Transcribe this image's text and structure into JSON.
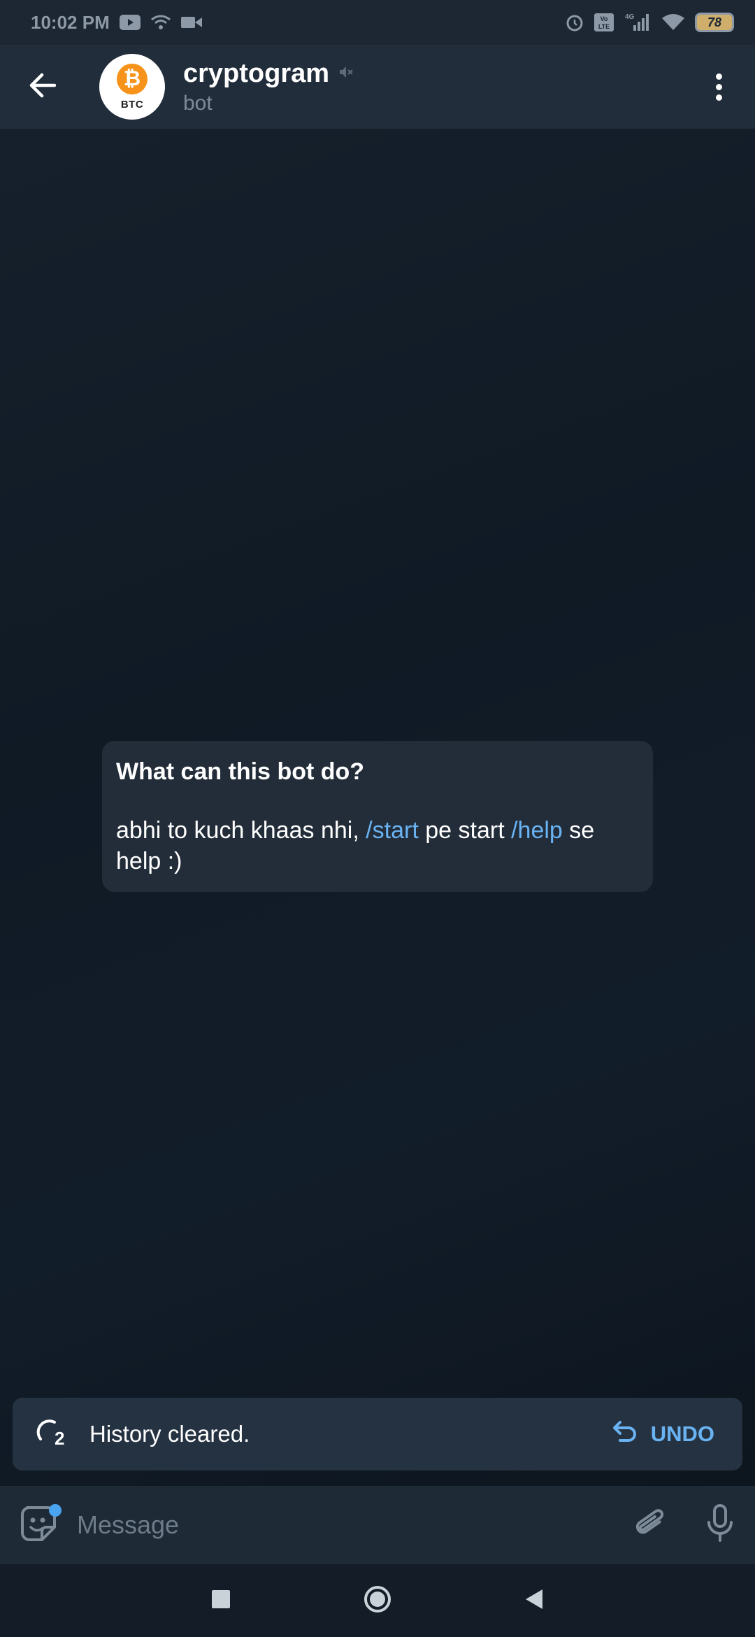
{
  "status_bar": {
    "time": "10:02 PM",
    "left_icons": [
      "youtube-icon",
      "wifi-hotspot-icon",
      "video-icon"
    ],
    "right_icons": [
      "alarm-icon",
      "volte-icon",
      "signal-4g-icon",
      "wifi-icon"
    ],
    "network_label": "4G",
    "volte_label": "Vo LTE",
    "battery": "78"
  },
  "header": {
    "title": "cryptogram",
    "subtitle": "bot",
    "avatar_symbol": "₿",
    "avatar_text": "BTC",
    "muted": true
  },
  "bot_info": {
    "title": "What can this bot do?",
    "body_part1": "abhi to kuch khaas nhi, ",
    "cmd_start": "/start",
    "body_part2": " pe start ",
    "cmd_help": "/help",
    "body_part3": " se help :)"
  },
  "snackbar": {
    "countdown": "2",
    "text": "History cleared.",
    "undo_label": "UNDO"
  },
  "composer": {
    "placeholder": "Message",
    "value": ""
  },
  "colors": {
    "accent": "#6ab3f3",
    "header_bg": "#212d3b",
    "card_bg": "#222d39",
    "bitcoin": "#f7931a"
  }
}
